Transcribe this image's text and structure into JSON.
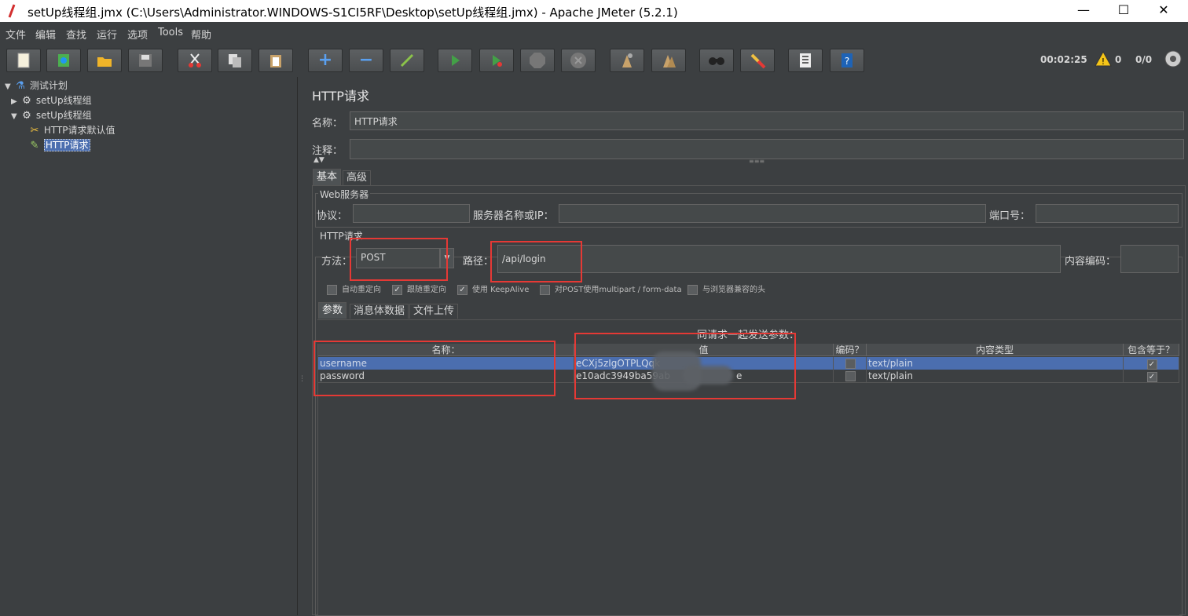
{
  "window": {
    "title": "setUp线程组.jmx (C:\\Users\\Administrator.WINDOWS-S1CI5RF\\Desktop\\setUp线程组.jmx) - Apache JMeter (5.2.1)",
    "minimize": "—",
    "maximize": "☐",
    "close": "✕"
  },
  "menu": [
    "文件",
    "编辑",
    "查找",
    "运行",
    "选项",
    "Tools",
    "帮助"
  ],
  "toolbar": {
    "icons": [
      "new-icon",
      "templates-icon",
      "open-icon",
      "save-icon",
      "cut-icon",
      "copy-icon",
      "paste-icon",
      "expand-icon",
      "collapse-icon",
      "toggle-icon",
      "start-icon",
      "start-no-pause-icon",
      "stop-icon",
      "shutdown-icon",
      "clear-icon",
      "clear-all-icon",
      "search-icon",
      "reset-search-icon",
      "function-helper-icon",
      "help-icon"
    ],
    "timer": "00:02:25",
    "warnings": "0",
    "threads": "0/0"
  },
  "tree": [
    {
      "label": "测试计划",
      "level": 0,
      "expanded": true,
      "icon": "flask-icon"
    },
    {
      "label": "setUp线程组",
      "level": 1,
      "expanded": false,
      "icon": "gear-icon"
    },
    {
      "label": "setUp线程组",
      "level": 1,
      "expanded": true,
      "icon": "gear-icon"
    },
    {
      "label": "HTTP请求默认值",
      "level": 2,
      "icon": "wrench-icon"
    },
    {
      "label": "HTTP请求",
      "level": 2,
      "icon": "pipette-icon",
      "selected": true
    }
  ],
  "panel": {
    "title": "HTTP请求",
    "name_label": "名称：",
    "name_value": "HTTP请求",
    "comment_label": "注释：",
    "comment_value": "",
    "tabs": [
      "基本",
      "高级"
    ],
    "web_server": {
      "title": "Web服务器",
      "protocol_label": "协议：",
      "protocol_value": "",
      "server_label": "服务器名称或IP：",
      "server_value": "",
      "port_label": "端口号：",
      "port_value": ""
    },
    "http_request": {
      "title": "HTTP请求",
      "method_label": "方法：",
      "method_value": "POST",
      "path_label": "路径：",
      "path_value": "/api/login",
      "encoding_label": "内容编码：",
      "encoding_value": "",
      "options": [
        {
          "label": "自动重定向",
          "checked": false
        },
        {
          "label": "跟随重定向",
          "checked": true
        },
        {
          "label": "使用 KeepAlive",
          "checked": true
        },
        {
          "label": "对POST使用multipart / form-data",
          "checked": false
        },
        {
          "label": "与浏览器兼容的头",
          "checked": false
        }
      ]
    },
    "param_tabs": [
      "参数",
      "消息体数据",
      "文件上传"
    ],
    "params_caption": "同请求一起发送参数：",
    "columns": [
      "名称：",
      "值",
      "编码？",
      "内容类型",
      "包含等于？"
    ],
    "rows": [
      {
        "name": "username",
        "value": "eCXj5zIgOTPLQqk",
        "encode": false,
        "content_type": "text/plain",
        "include_equals": true,
        "selected": true
      },
      {
        "name": "password",
        "value": "e10adc3949ba59ab",
        "value_tail": "e",
        "encode": false,
        "content_type": "text/plain",
        "include_equals": true,
        "selected": false
      }
    ]
  }
}
